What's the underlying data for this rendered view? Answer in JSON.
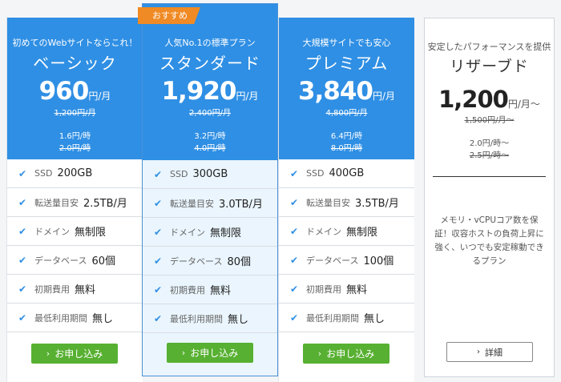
{
  "plans": [
    {
      "tagline": "初めてのWebサイトならこれ！",
      "name": "ベーシック",
      "price": "960",
      "unit": "円/月",
      "old_price": "1,200円/月",
      "hourly": "1.6円/時",
      "hourly_old": "2.0円/時",
      "features": [
        {
          "label": "SSD",
          "value": "200GB"
        },
        {
          "label": "転送量目安",
          "value": "2.5TB/月"
        },
        {
          "label": "ドメイン",
          "value": "無制限"
        },
        {
          "label": "データベース",
          "value": "60個"
        },
        {
          "label": "初期費用",
          "value": "無料"
        },
        {
          "label": "最低利用期間",
          "value": "無し"
        }
      ],
      "button": "お申し込み"
    },
    {
      "badge": "おすすめ",
      "tagline": "人気No.1の標準プラン",
      "name": "スタンダード",
      "price": "1,920",
      "unit": "円/月",
      "old_price": "2,400円/月",
      "hourly": "3.2円/時",
      "hourly_old": "4.0円/時",
      "features": [
        {
          "label": "SSD",
          "value": "300GB"
        },
        {
          "label": "転送量目安",
          "value": "3.0TB/月"
        },
        {
          "label": "ドメイン",
          "value": "無制限"
        },
        {
          "label": "データベース",
          "value": "80個"
        },
        {
          "label": "初期費用",
          "value": "無料"
        },
        {
          "label": "最低利用期間",
          "value": "無し"
        }
      ],
      "button": "お申し込み"
    },
    {
      "tagline": "大規模サイトでも安心",
      "name": "プレミアム",
      "price": "3,840",
      "unit": "円/月",
      "old_price": "4,800円/月",
      "hourly": "6.4円/時",
      "hourly_old": "8.0円/時",
      "features": [
        {
          "label": "SSD",
          "value": "400GB"
        },
        {
          "label": "転送量目安",
          "value": "3.5TB/月"
        },
        {
          "label": "ドメイン",
          "value": "無制限"
        },
        {
          "label": "データベース",
          "value": "100個"
        },
        {
          "label": "初期費用",
          "value": "無料"
        },
        {
          "label": "最低利用期間",
          "value": "無し"
        }
      ],
      "button": "お申し込み"
    }
  ],
  "reserved": {
    "tagline": "安定したパフォーマンスを提供",
    "name": "リザーブド",
    "price": "1,200",
    "unit": "円/月〜",
    "old_price": "1,500円/月〜",
    "hourly": "2.0円/時〜",
    "hourly_old": "2.5円/時〜",
    "description": "メモリ・vCPUコア数を保証！収容ホストの負荷上昇に強く、いつでも安定稼動できるプラン",
    "button": "詳細"
  },
  "colors": {
    "header_blue": "#2f8fe4",
    "button_green": "#57b031",
    "badge_orange": "#f08a24",
    "check_blue": "#2f8fe4"
  },
  "icons": {
    "check": "checkmark-icon",
    "button_chevron": "chevron-right-icon"
  }
}
